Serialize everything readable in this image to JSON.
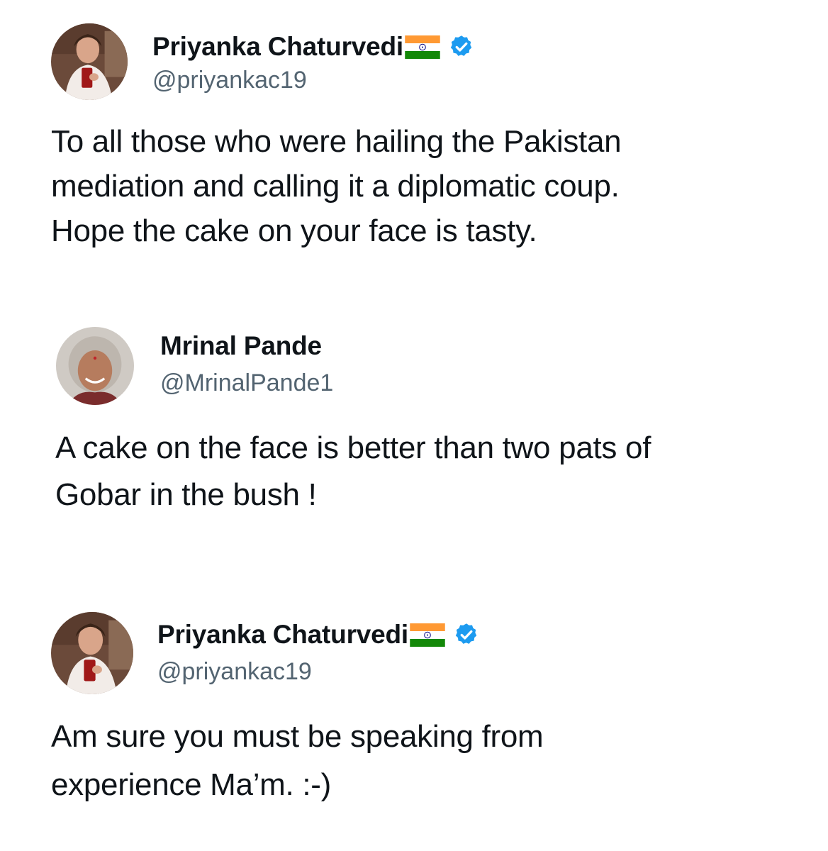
{
  "tweets": [
    {
      "author_name": "Priyanka Chaturvedi",
      "handle": "@priyankac19",
      "verified": true,
      "flag_icon": "india-flag-icon",
      "text": "To all those who were hailing the Pakistan\nmediation and calling it a diplomatic coup.\nHope the cake on your face is tasty."
    },
    {
      "author_name": "Mrinal Pande",
      "handle": "@MrinalPande1",
      "verified": false,
      "text": "A cake on the face is better than two pats of\nGobar in the bush !"
    },
    {
      "author_name": "Priyanka Chaturvedi",
      "handle": "@priyankac19",
      "verified": true,
      "flag_icon": "india-flag-icon",
      "text": "Am sure you must be speaking from\nexperience Ma’m. :-)"
    }
  ],
  "colors": {
    "text": "#0f1419",
    "secondary": "#536471",
    "verified_badge": "#1d9bf0",
    "flag_saffron": "#ff9933",
    "flag_green": "#138808",
    "flag_chakra": "#000080"
  }
}
